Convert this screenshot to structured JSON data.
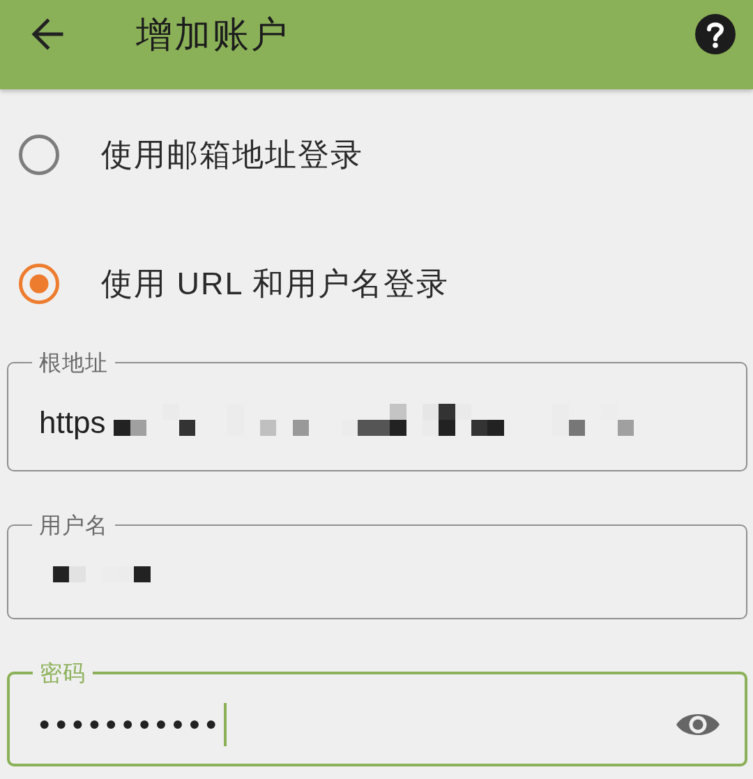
{
  "app_bar": {
    "title": "增加账户"
  },
  "login_options": [
    {
      "label": "使用邮箱地址登录",
      "selected": false
    },
    {
      "label": "使用 URL 和用户名登录",
      "selected": true
    }
  ],
  "fields": [
    {
      "kind": "text",
      "label": "根地址",
      "value": "https",
      "redacted": true,
      "focused": false
    },
    {
      "kind": "text",
      "label": "用户名",
      "redacted": true,
      "focused": false
    },
    {
      "kind": "password",
      "label": "密码",
      "value": "•••••••••••",
      "redacted": false,
      "focused": true
    }
  ]
}
